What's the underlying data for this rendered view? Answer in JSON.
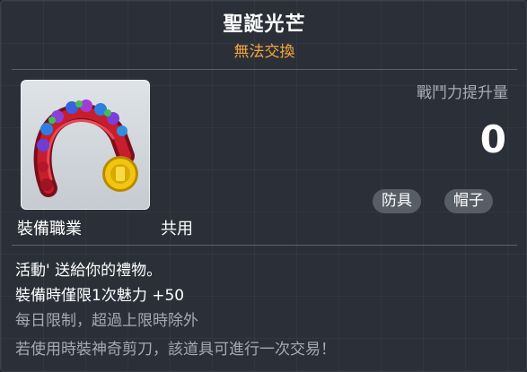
{
  "item": {
    "name": "聖誕光芒",
    "trade_status": "無法交換",
    "job_label": "裝備職業",
    "job_value": "共用",
    "icon": "christmas-headband-icon"
  },
  "stats": {
    "power_label": "戰鬥力提升量",
    "power_value": "0"
  },
  "tags": [
    "防具",
    "帽子"
  ],
  "description": {
    "line1": "活動' 送給你的禮物。",
    "line2": "裝備時僅限1次魅力  +50",
    "line3": "每日限制，超過上限時除外",
    "line4": "若使用時裝神奇剪刀，該道具可進行一次交易！"
  },
  "colors": {
    "background": "#2b3038",
    "trade_status": "#f5a43a",
    "muted_text": "#a3aab4",
    "tag_background": "#575e68"
  }
}
